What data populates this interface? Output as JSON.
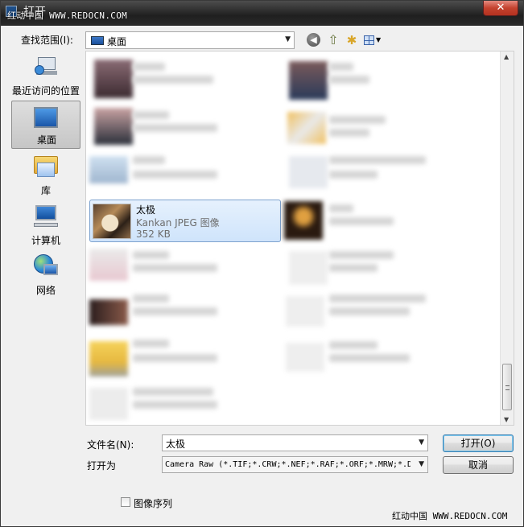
{
  "titlebar": {
    "title": "打开",
    "watermark": "红动中国 WWW.REDOCN.COM",
    "close_glyph": "✕"
  },
  "toolbar": {
    "look_in_label": "查找范围(I):",
    "look_in_value": "桌面"
  },
  "places": [
    {
      "label": "最近访问的位置",
      "icon": "recent-places-icon",
      "selected": false
    },
    {
      "label": "桌面",
      "icon": "desktop-icon",
      "selected": true
    },
    {
      "label": "库",
      "icon": "library-icon",
      "selected": false
    },
    {
      "label": "计算机",
      "icon": "computer-icon",
      "selected": false
    },
    {
      "label": "网络",
      "icon": "network-icon",
      "selected": false
    }
  ],
  "selected_file": {
    "name": "太极",
    "type": "Kankan JPEG 图像",
    "size": "352 KB"
  },
  "bottom": {
    "file_name_label": "文件名(N):",
    "file_name_value": "太极",
    "file_type_label": "打开为",
    "file_type_value": "Camera Raw (*.TIF;*.CRW;*.NEF;*.RAF;*.ORF;*.MRW;*.D",
    "open_button": "打开(O)",
    "cancel_button": "取消",
    "image_sequence_label": "图像序列",
    "watermark": "红动中国 WWW.REDOCN.COM"
  },
  "colors": {
    "selection_bg": "#cfe4fb",
    "selection_border": "#7da2ce",
    "close_red": "#c4422f"
  }
}
